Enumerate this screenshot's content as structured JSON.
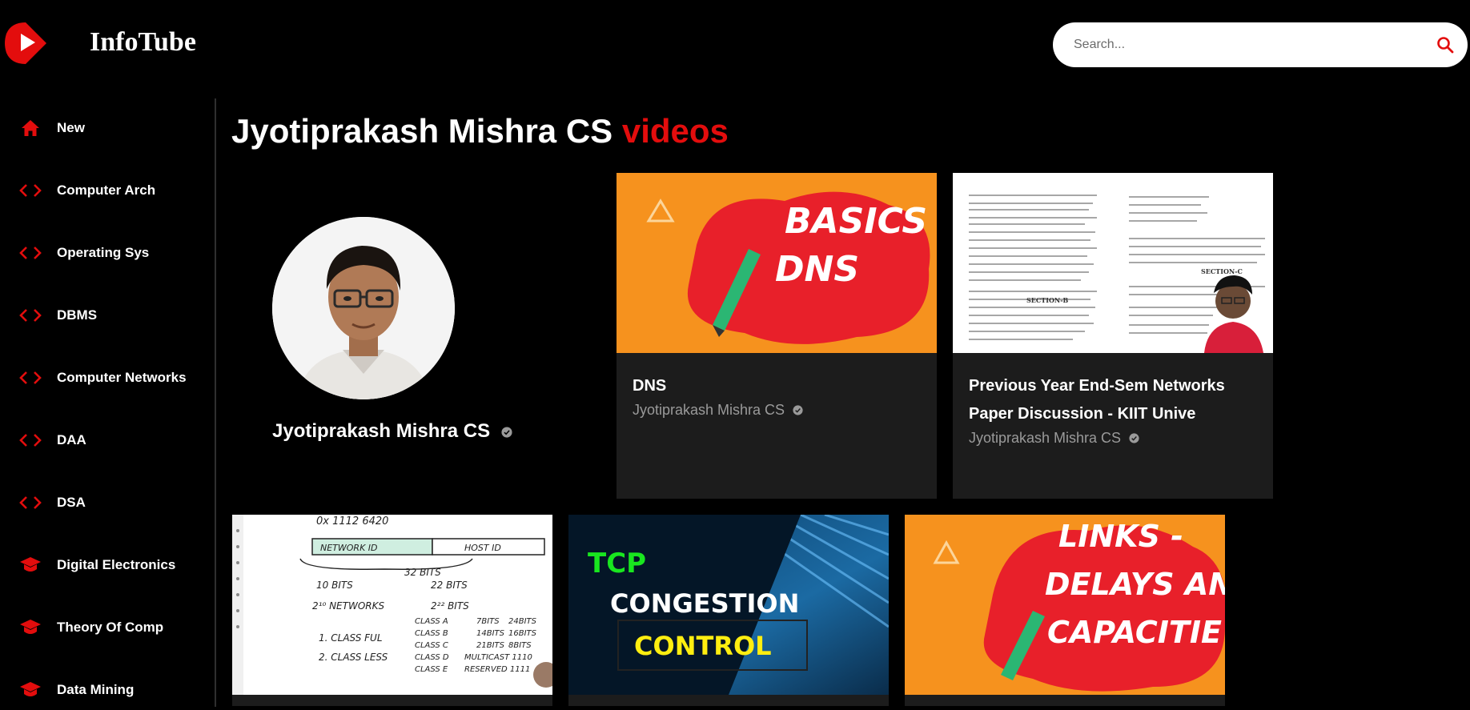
{
  "app": {
    "brand": "InfoTube",
    "accent_color": "#e30d0d"
  },
  "search": {
    "placeholder": "Search...",
    "icon": "search-icon"
  },
  "sidebar": {
    "items": [
      {
        "label": "New",
        "icon": "home-icon"
      },
      {
        "label": "Computer Arch",
        "icon": "code-icon"
      },
      {
        "label": "Operating Sys",
        "icon": "code-icon"
      },
      {
        "label": "DBMS",
        "icon": "code-icon"
      },
      {
        "label": "Computer Networks",
        "icon": "code-icon"
      },
      {
        "label": "DAA",
        "icon": "code-icon"
      },
      {
        "label": "DSA",
        "icon": "code-icon"
      },
      {
        "label": "Digital Electronics",
        "icon": "graduation-cap-icon"
      },
      {
        "label": "Theory Of Comp",
        "icon": "graduation-cap-icon"
      },
      {
        "label": "Data Mining",
        "icon": "graduation-cap-icon"
      }
    ]
  },
  "main": {
    "title_name": "Jyotiprakash Mishra CS",
    "title_suffix": "videos",
    "channel": {
      "name": "Jyotiprakash Mishra CS"
    },
    "videos": [
      {
        "title": "DNS",
        "channel": "Jyotiprakash Mishra CS",
        "thumb_text": [
          "BASICS O",
          "DNS"
        ]
      },
      {
        "title": "Previous Year End-Sem Networks Paper Discussion - KIIT Unive",
        "channel": "Jyotiprakash Mishra CS",
        "thumb_text": [
          "SECTION-C",
          "SECTION-B"
        ]
      },
      {
        "thumb_text": [
          "0x 1112 6420",
          "NETWORK ID",
          "HOST ID",
          "32 BITS",
          "10 BITS",
          "22 BITS",
          "2¹⁰ NETWORKS",
          "2²² BITS",
          "1. CLASS FUL",
          "2. CLASS LESS",
          "CLASS A",
          "CLASS B",
          "CLASS C",
          "CLASS D",
          "CLASS E",
          "7BITS",
          "24BITS",
          "14BITS",
          "16BITS",
          "21BITS",
          "8BITS",
          "MULTICAST 1110",
          "RESERVED 1111"
        ]
      },
      {
        "thumb_text": [
          "TCP",
          "CONGESTION",
          "CONTROL"
        ]
      },
      {
        "thumb_text": [
          "LINKS -",
          "DELAYS AN",
          "CAPACITIE"
        ]
      }
    ]
  }
}
